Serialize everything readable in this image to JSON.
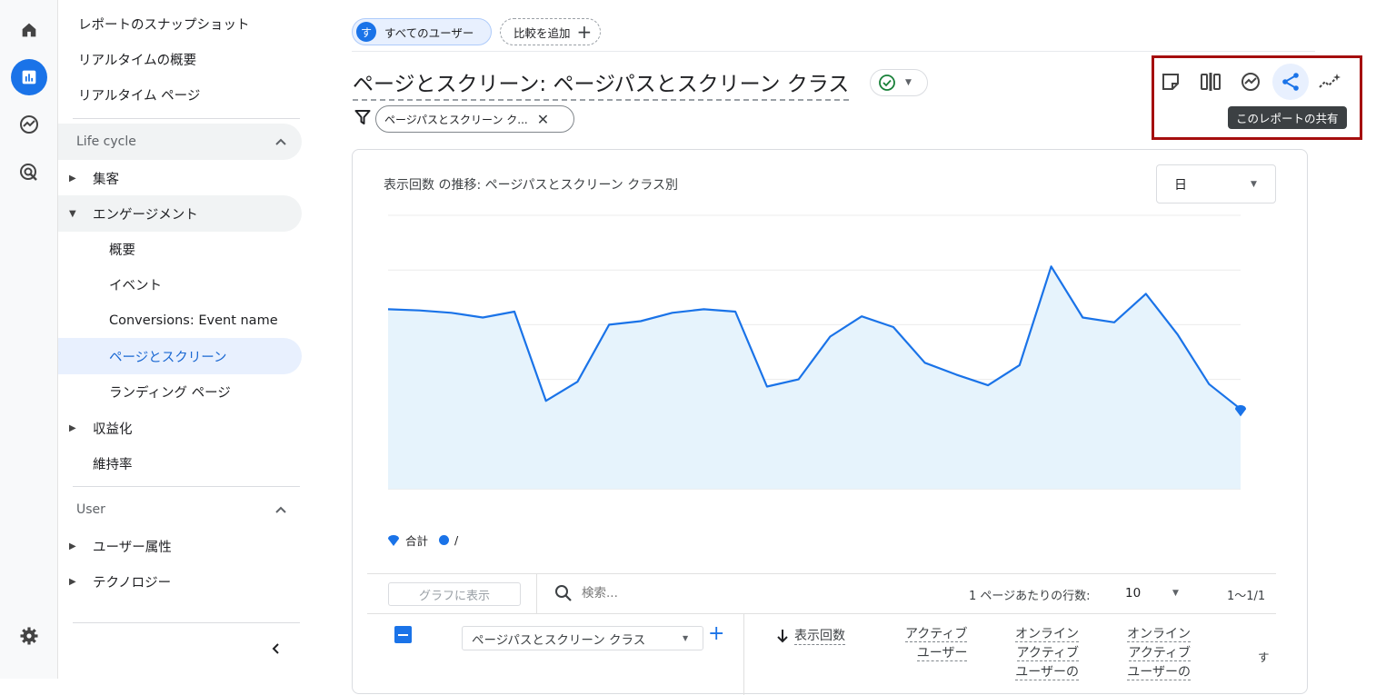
{
  "nav": {
    "top_items": [
      "レポートのスナップショット",
      "リアルタイムの概要",
      "リアルタイム ページ"
    ],
    "lifecycle_label": "Life cycle",
    "lifecycle": {
      "acquisition": "集客",
      "engagement": "エンゲージメント",
      "engagement_children": [
        "概要",
        "イベント",
        "Conversions: Event name",
        "ページとスクリーン",
        "ランディング ページ"
      ],
      "monetization": "収益化",
      "retention": "維持率"
    },
    "user_label": "User",
    "user": {
      "demographics": "ユーザー属性",
      "technology": "テクノロジー"
    }
  },
  "header": {
    "segment_avatar": "す",
    "segment_chip": "すべてのユーザー",
    "add_compare": "比較を追加",
    "title": "ページとスクリーン: ページパスとスクリーン クラス",
    "filter_chip": "ページパスとスクリーン ク...",
    "share_tooltip": "このレポートの共有"
  },
  "chart_card": {
    "title": "表示回数 の推移: ページパスとスクリーン クラス別",
    "granularity": "日",
    "legend": [
      {
        "label": "合計",
        "color": "#1a73e8",
        "marker": "teardrop"
      },
      {
        "label": "/",
        "color": "#1a73e8",
        "marker": "dot"
      }
    ]
  },
  "chart_data": {
    "type": "area",
    "title": "表示回数 の推移: ページパスとスクリーン クラス別",
    "xlabel": "",
    "ylabel": "",
    "grid": true,
    "series_color": "#1a73e8",
    "fill_color": "#e6f3fc",
    "x": [
      1,
      2,
      3,
      4,
      5,
      6,
      7,
      8,
      9,
      10,
      11,
      12,
      13,
      14,
      15,
      16,
      17,
      18,
      19,
      20,
      21,
      22,
      23,
      24,
      25,
      26,
      27,
      28
    ],
    "values": [
      60.5,
      60,
      59,
      57,
      59.5,
      22,
      30,
      54,
      55.5,
      59,
      60.5,
      59.5,
      28,
      31,
      49,
      57.5,
      53,
      38,
      33,
      28.5,
      37,
      78.5,
      57,
      55,
      67,
      50,
      29,
      18.5
    ],
    "ylim": [
      -15,
      100
    ]
  },
  "table": {
    "plot_button": "グラフに表示",
    "search_placeholder": "検索...",
    "rows_per_page_label": "1 ページあたりの行数:",
    "rows_per_page_value": "10",
    "pagination": "1〜1/1",
    "dimension_select": "ページパスとスクリーン クラス",
    "col_views": "表示回数",
    "col_active_users": [
      "アクティブ",
      "ユーザー"
    ],
    "col_online1": [
      "オンライン",
      "アクティブ",
      "ユーザーの"
    ],
    "col_online2": [
      "オンライン",
      "アクティブ",
      "ユーザーの"
    ],
    "col_cut": "す"
  }
}
